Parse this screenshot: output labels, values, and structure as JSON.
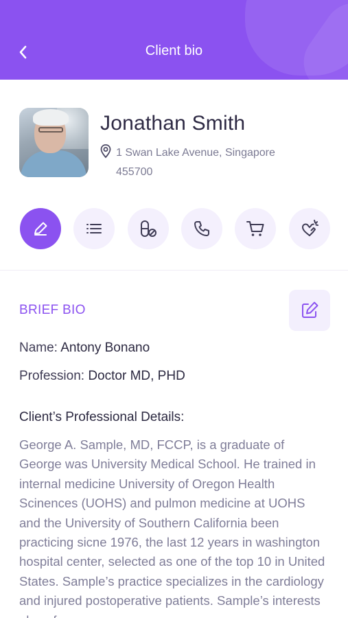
{
  "header": {
    "title": "Client bio",
    "background": "#8b52f0",
    "back_icon": "chevron-left-icon"
  },
  "profile": {
    "name": "Jonathan Smith",
    "address_line1": "1 Swan Lake Avenue, Singapore",
    "address_line2": "455700",
    "location_icon": "map-pin-icon"
  },
  "actions": [
    {
      "icon": "pencil-icon",
      "active": true
    },
    {
      "icon": "list-icon",
      "active": false
    },
    {
      "icon": "pill-icon",
      "active": false
    },
    {
      "icon": "phone-icon",
      "active": false
    },
    {
      "icon": "cart-icon",
      "active": false
    },
    {
      "icon": "heart-hands-icon",
      "active": false
    }
  ],
  "bio": {
    "section_title": "BRIEF BIO",
    "name_label": "Name: ",
    "name_value": "Antony Bonano",
    "profession_label": "Profession: ",
    "profession_value": "Doctor MD, PHD",
    "details_title": "Client’s Professional Details:",
    "details_text": "George A. Sample, MD, FCCP, is a graduate of George was University Medical School. He trained in internal medicine University of Oregon Health Scinences (UOHS) and pulmon medicine at UOHS and the University of Southern California been practicing sicne 1976, the last 12 years in washington hospital center, selected as one of the top 10 in United States. Sample’s practice specializes in the cardiology and injured postoperative patients. Sample’s interests also of"
  },
  "colors": {
    "accent": "#8b52f0",
    "accent_light": "#f4f0fd",
    "text_dark": "#2e2a44",
    "text_muted": "#7f7d98"
  }
}
